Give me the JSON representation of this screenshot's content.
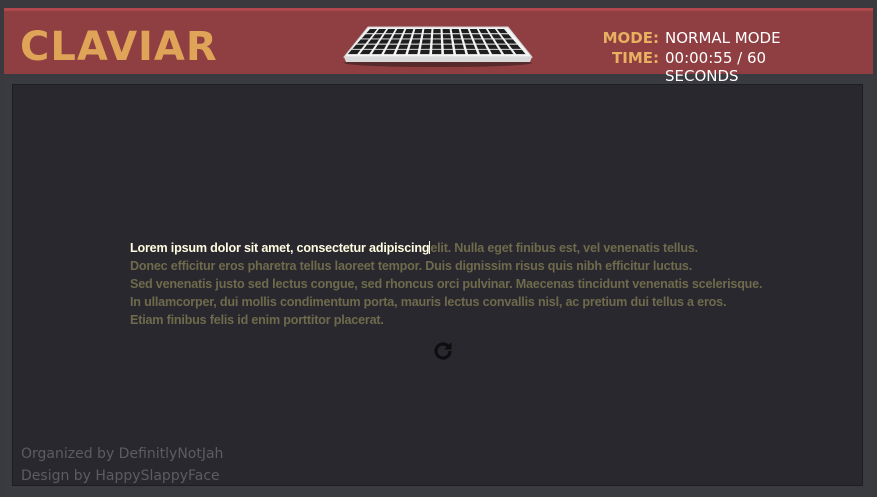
{
  "header": {
    "logo": "CLAVIAR",
    "keyboard_icon": "keyboard-icon",
    "mode_label": "MODE:",
    "mode_value": "NORMAL MODE",
    "time_label": "TIME:",
    "time_value": "00:00:55 / 60 SECONDS"
  },
  "typing": {
    "typed_text": "Lorem ipsum dolor sit amet, consectetur adipiscing",
    "pending_lines": [
      "elit. Nulla eget finibus est, vel venenatis tellus.",
      "Donec efficitur eros pharetra tellus laoreet tempor. Duis dignissim risus quis nibh efficitur luctus.",
      "Sed venenatis justo sed lectus congue, sed rhoncus orci pulvinar. Maecenas tincidunt venenatis scelerisque.",
      "In ullamcorper, dui mollis condimentum porta, mauris lectus convallis nisl, ac pretium dui tellus a eros.",
      "Etiam finibus felis id enim porttitor placerat."
    ]
  },
  "restart": {
    "icon": "refresh-icon"
  },
  "footer": {
    "organized": "Organized by DefinitlyNotJah",
    "design": "Design by HappySlappyFace"
  },
  "colors": {
    "header_bg": "#8f3f42",
    "logo": "#e0a458",
    "label": "#e8b060",
    "panel_bg": "#28282e",
    "typed": "#fffbe0",
    "pending": "#6f6a4c"
  }
}
